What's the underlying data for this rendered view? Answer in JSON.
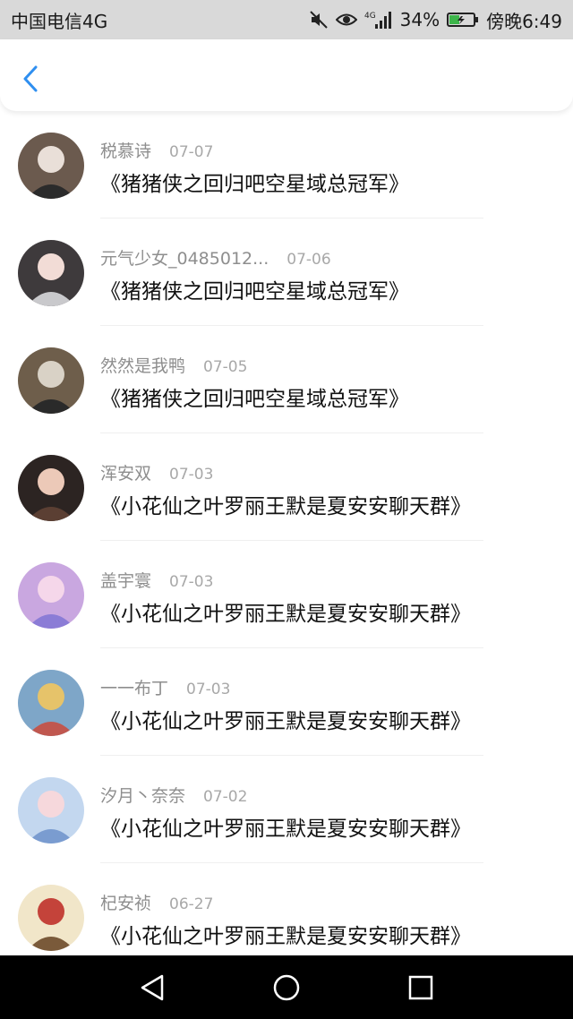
{
  "status_bar": {
    "carrier": "中国电信4G",
    "network_label": "4G",
    "battery": "34%",
    "time": "傍晚6:49"
  },
  "nav": {
    "back_icon": "chevron-left-icon",
    "accent": "#2f8ff0"
  },
  "items": [
    {
      "name": "税慕诗",
      "date": "07-07",
      "message": "《猪猪侠之回归吧空星域总冠军》",
      "avatar_colors": [
        "#6b5a4e",
        "#e9dfd8",
        "#2b2b2b"
      ]
    },
    {
      "name": "元气少女_0485012...",
      "date": "07-06",
      "message": "《猪猪侠之回归吧空星域总冠军》",
      "avatar_colors": [
        "#3e3a3c",
        "#f2dcd6",
        "#c9c9cc"
      ]
    },
    {
      "name": "然然是我鸭",
      "date": "07-05",
      "message": "《猪猪侠之回归吧空星域总冠军》",
      "avatar_colors": [
        "#6e5e4b",
        "#d9d2c6",
        "#2a2a2a"
      ]
    },
    {
      "name": "浑安双",
      "date": "07-03",
      "message": "《小花仙之叶罗丽王默是夏安安聊天群》",
      "avatar_colors": [
        "#2c2422",
        "#ecc9b8",
        "#5b3f33"
      ]
    },
    {
      "name": "盖宇寰",
      "date": "07-03",
      "message": "《小花仙之叶罗丽王默是夏安安聊天群》",
      "avatar_colors": [
        "#c9a7e0",
        "#f5d7ea",
        "#8b7cd6"
      ]
    },
    {
      "name": "一一布丁",
      "date": "07-03",
      "message": "《小花仙之叶罗丽王默是夏安安聊天群》",
      "avatar_colors": [
        "#7ea6c8",
        "#e6c36a",
        "#c0574f"
      ]
    },
    {
      "name": "汐月丶奈奈",
      "date": "07-02",
      "message": "《小花仙之叶罗丽王默是夏安安聊天群》",
      "avatar_colors": [
        "#c3d7ef",
        "#f6d8dc",
        "#7a9cd0"
      ]
    },
    {
      "name": "杞安祯",
      "date": "06-27",
      "message": "《小花仙之叶罗丽王默是夏安安聊天群》",
      "avatar_colors": [
        "#f1e6c9",
        "#c4433a",
        "#7a5a3a"
      ]
    }
  ],
  "system_nav": {
    "back": "triangle-back-icon",
    "home": "circle-home-icon",
    "recents": "square-recents-icon"
  }
}
